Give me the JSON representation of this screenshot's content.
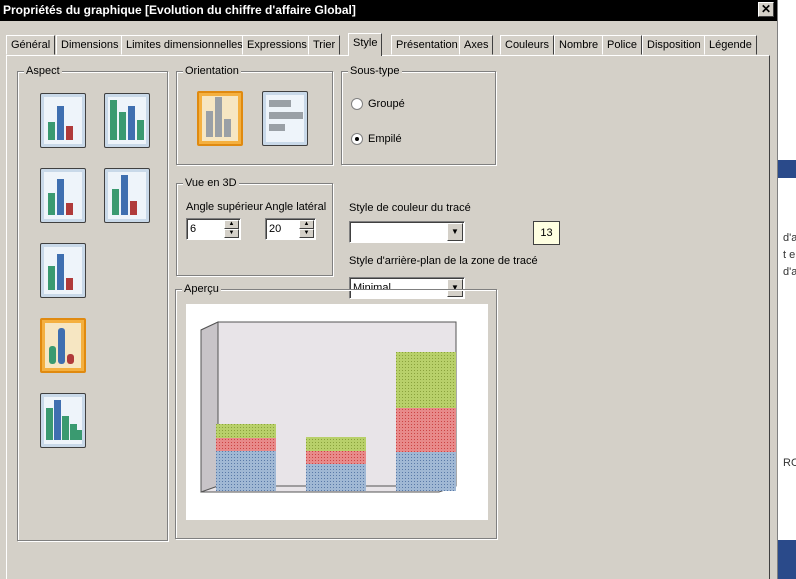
{
  "window": {
    "title": "Propriétés du graphique [Evolution du chiffre d'affaire Global]",
    "close_glyph": "✕"
  },
  "tabs": [
    {
      "label": "Général"
    },
    {
      "label": "Dimensions"
    },
    {
      "label": "Limites dimensionnelles"
    },
    {
      "label": "Expressions"
    },
    {
      "label": "Trier"
    },
    {
      "label": "Style",
      "active": true
    },
    {
      "label": "Présentation"
    },
    {
      "label": "Axes"
    },
    {
      "label": "Couleurs"
    },
    {
      "label": "Nombre"
    },
    {
      "label": "Police"
    },
    {
      "label": "Disposition"
    },
    {
      "label": "Légende"
    }
  ],
  "aspect": {
    "label": "Aspect",
    "selected_index": 5,
    "icons": [
      "bar-flat-icon",
      "bar-3d-cluster-icon",
      "bar-flat-alt-icon",
      "bar-cylinder-icon",
      "bar-3d-icon",
      "cylinder-3d-icon",
      "bar-3d-stacked-icon"
    ]
  },
  "orientation": {
    "label": "Orientation",
    "selected": "vertical",
    "icons": [
      "vertical-bars-icon",
      "horizontal-bars-icon"
    ]
  },
  "subtype": {
    "label": "Sous-type",
    "options": [
      "Groupé",
      "Empilé"
    ],
    "selected": "Empilé"
  },
  "view3d": {
    "label": "Vue en 3D",
    "top_angle_label": "Angle supérieur",
    "side_angle_label": "Angle latéral",
    "top_angle": "6",
    "side_angle": "20"
  },
  "plot_color_style": {
    "label": "Style de couleur du tracé",
    "value": ""
  },
  "plot_bg_style": {
    "label": "Style d'arrière-plan de la zone de tracé",
    "value": "Minimal"
  },
  "size_badge": "13",
  "preview": {
    "label": "Aperçu"
  },
  "right_strip": {
    "lines": [
      "d'a",
      "t en",
      "d'a",
      "ROD"
    ]
  }
}
